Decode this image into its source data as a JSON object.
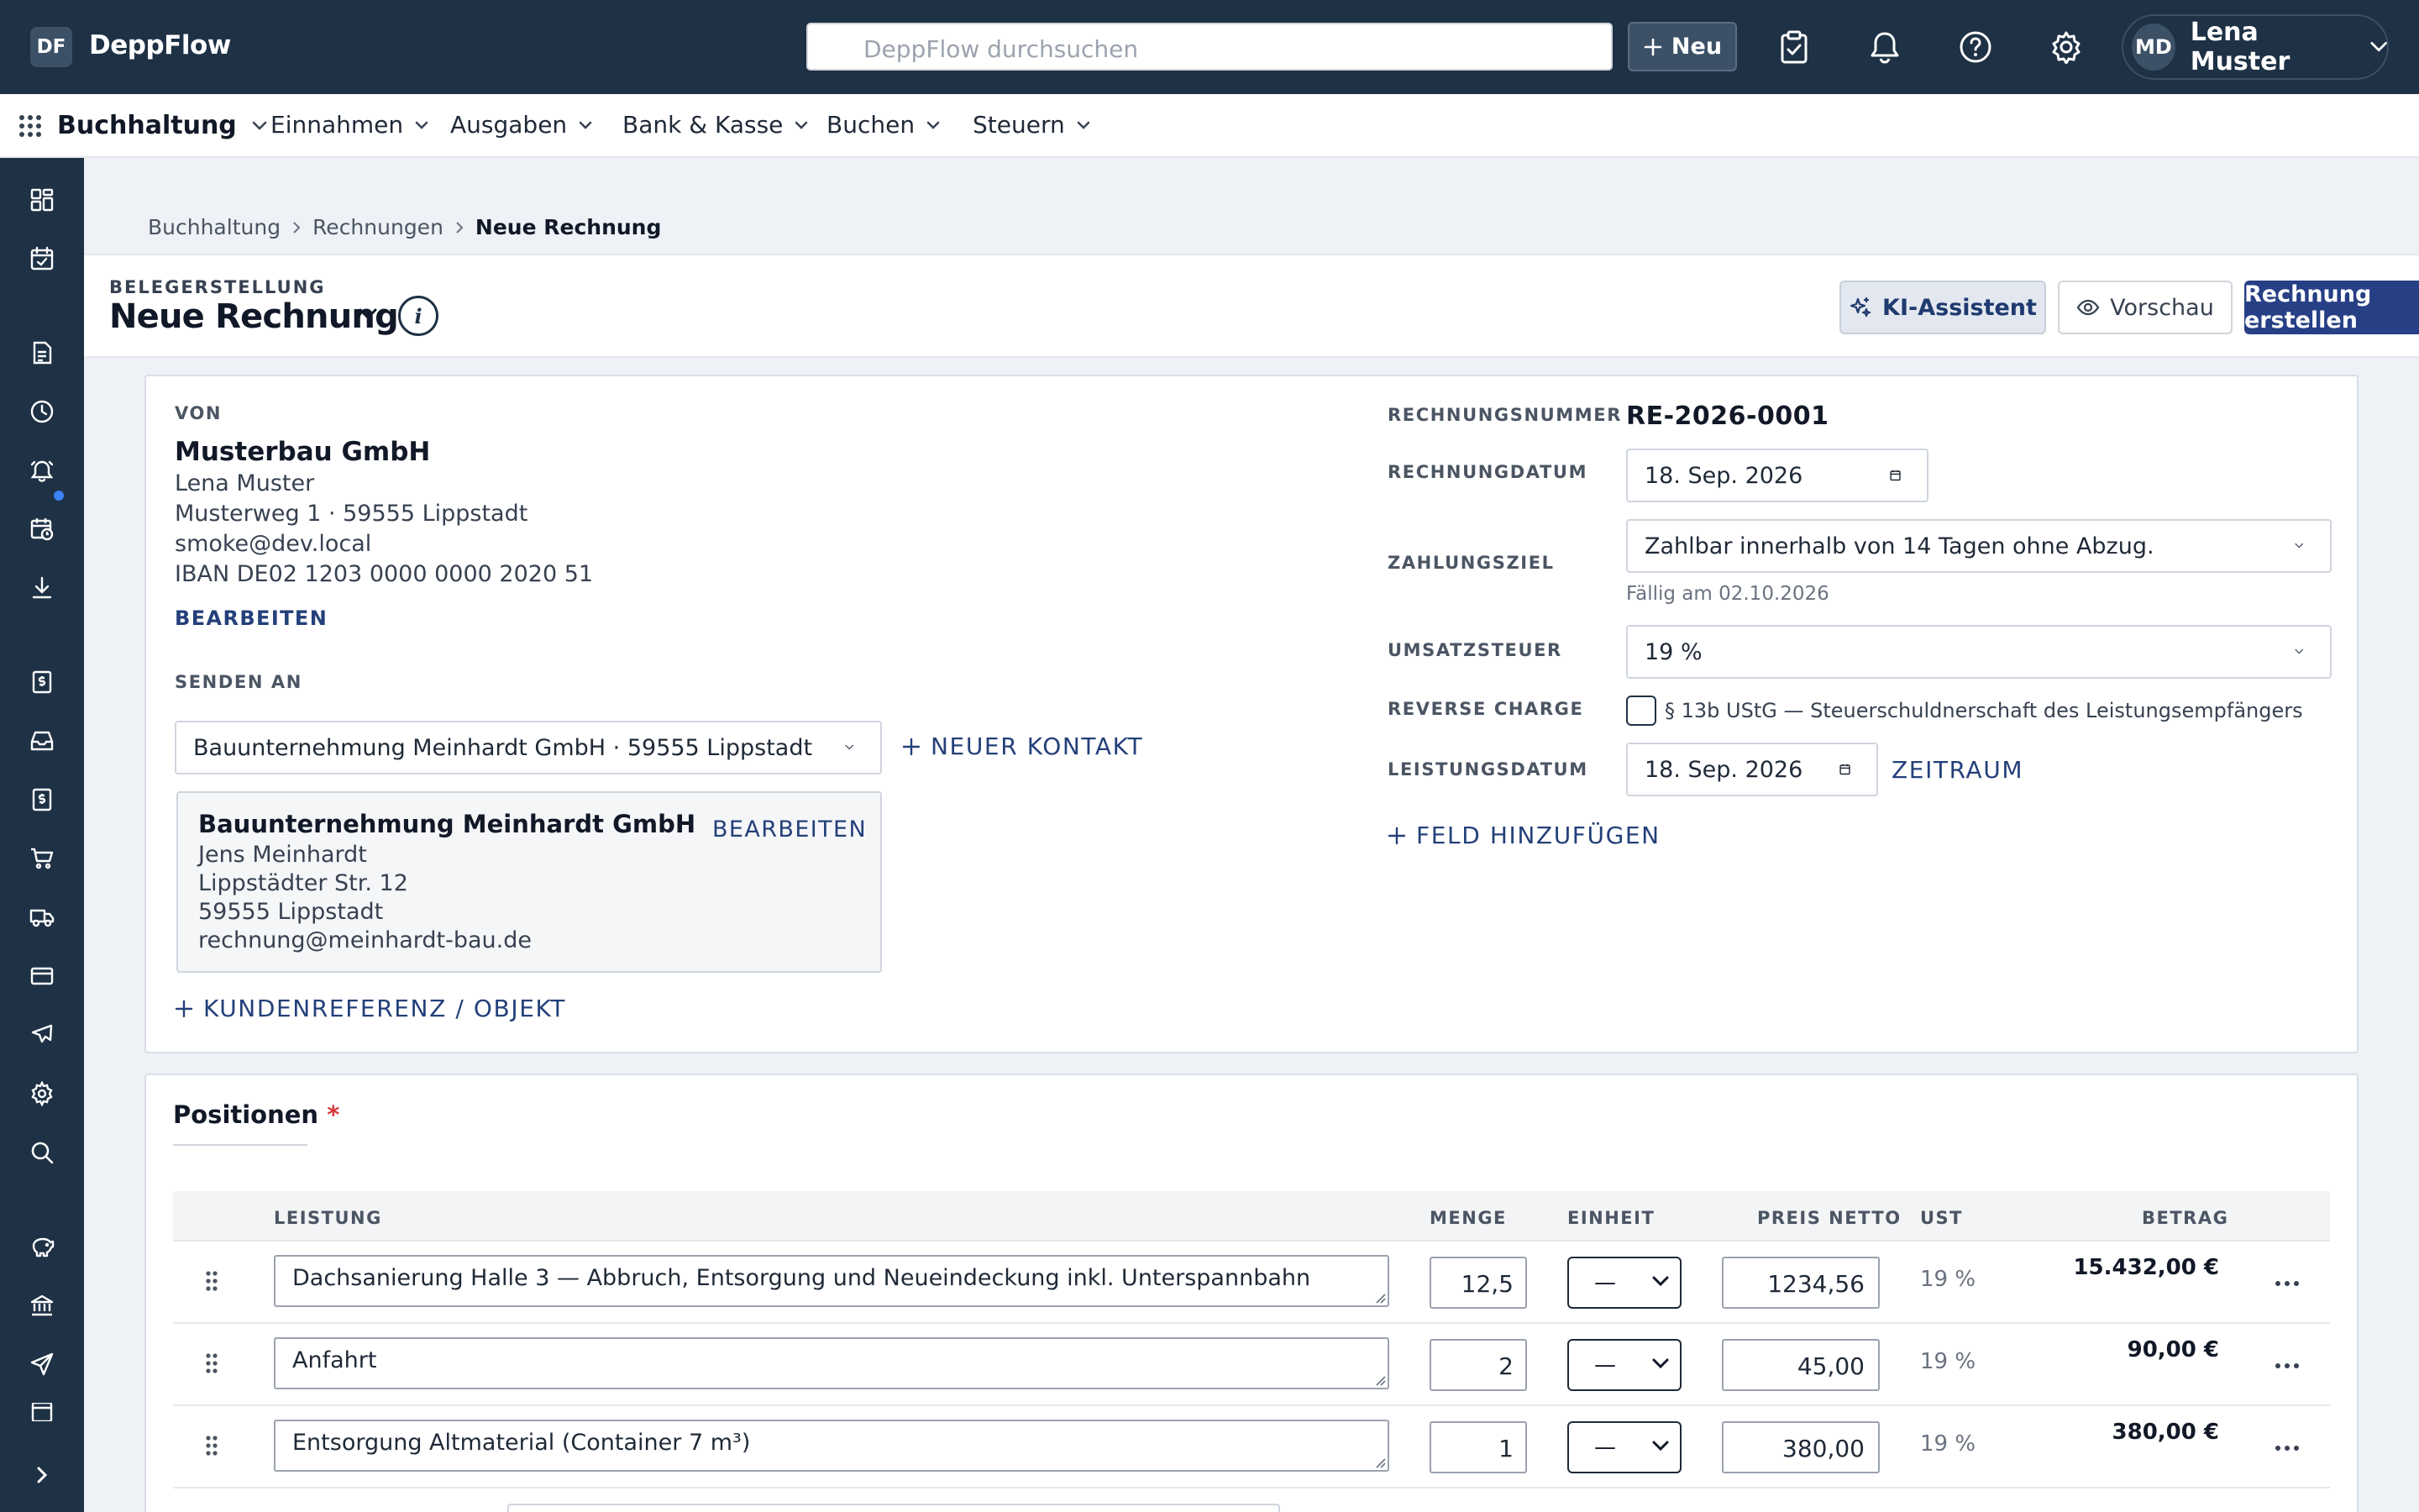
{
  "app": {
    "logo_badge": "DF",
    "name": "DeppFlow"
  },
  "topbar": {
    "search_placeholder": "DeppFlow durchsuchen",
    "new_label": "Neu",
    "user_initials": "MD",
    "user_name": "Lena Muster"
  },
  "modnav": {
    "module": "Buchhaltung",
    "items": [
      "Einnahmen",
      "Ausgaben",
      "Bank & Kasse",
      "Buchen",
      "Steuern"
    ]
  },
  "breadcrumb": [
    "Buchhaltung",
    "Rechnungen",
    "Neue Rechnung"
  ],
  "header": {
    "overline": "BELEGERSTELLUNG",
    "title": "Neue Rechnung",
    "ki_label": "KI-Assistent",
    "preview_label": "Vorschau",
    "create_label": "Rechnung erstellen"
  },
  "from": {
    "label": "VON",
    "company": "Musterbau GmbH",
    "person": "Lena Muster",
    "address": "Musterweg 1 · 59555 Lippstadt",
    "email": "smoke@dev.local",
    "iban": "IBAN DE02 1203 0000 0000 2020 51",
    "edit_label": "BEARBEITEN"
  },
  "to": {
    "label": "SENDEN AN",
    "select_value": "Bauunternehmung Meinhardt GmbH · 59555 Lippstadt",
    "new_contact_label": "NEUER KONTAKT",
    "company": "Bauunternehmung Meinhardt GmbH",
    "person": "Jens Meinhardt",
    "street": "Lippstädter Str. 12",
    "city": "59555 Lippstadt",
    "email": "rechnung@meinhardt-bau.de",
    "edit_label": "BEARBEITEN",
    "customer_ref_label": "KUNDENREFERENZ / OBJEKT"
  },
  "meta": {
    "number_label": "RECHNUNGSNUMMER",
    "number": "RE-2026-0001",
    "date_label": "RECHNUNGDATUM",
    "date": "18. Sep. 2026",
    "terms_label": "ZAHLUNGSZIEL",
    "terms": "Zahlbar innerhalb von 14 Tagen ohne Abzug.",
    "due_note": "Fällig am 02.10.2026",
    "vat_label": "UMSATZSTEUER",
    "vat": "19 %",
    "reverse_label": "REVERSE CHARGE",
    "reverse_text": "§ 13b UStG — Steuerschuldnerschaft des Leistungsempfängers",
    "reverse_checked": false,
    "service_date_label": "LEISTUNGSDATUM",
    "service_date": "18. Sep. 2026",
    "period_label": "ZEITRAUM",
    "add_field_label": "FELD HINZUFÜGEN"
  },
  "positions": {
    "title": "Positionen",
    "required_mark": "*",
    "columns": [
      "LEISTUNG",
      "MENGE",
      "EINHEIT",
      "PREIS NETTO",
      "UST",
      "BETRAG"
    ],
    "rows": [
      {
        "description": "Dachsanierung Halle 3 — Abbruch, Entsorgung und Neueindeckung inkl. Unterspannbahn",
        "qty": "12,5",
        "unit": "—",
        "price": "1234,56",
        "vat": "19 %",
        "amount": "15.432,00 €"
      },
      {
        "description": "Anfahrt",
        "qty": "2",
        "unit": "—",
        "price": "45,00",
        "vat": "19 %",
        "amount": "90,00 €"
      },
      {
        "description": "Entsorgung Altmaterial (Container 7 m³)",
        "qty": "1",
        "unit": "—",
        "price": "380,00",
        "vat": "19 %",
        "amount": "380,00 €"
      }
    ]
  },
  "colors": {
    "topbar": "#1e3145",
    "primary": "#263f85",
    "link": "#24407a",
    "required": "#d9363e",
    "notify_dot": "#3b82f6"
  }
}
